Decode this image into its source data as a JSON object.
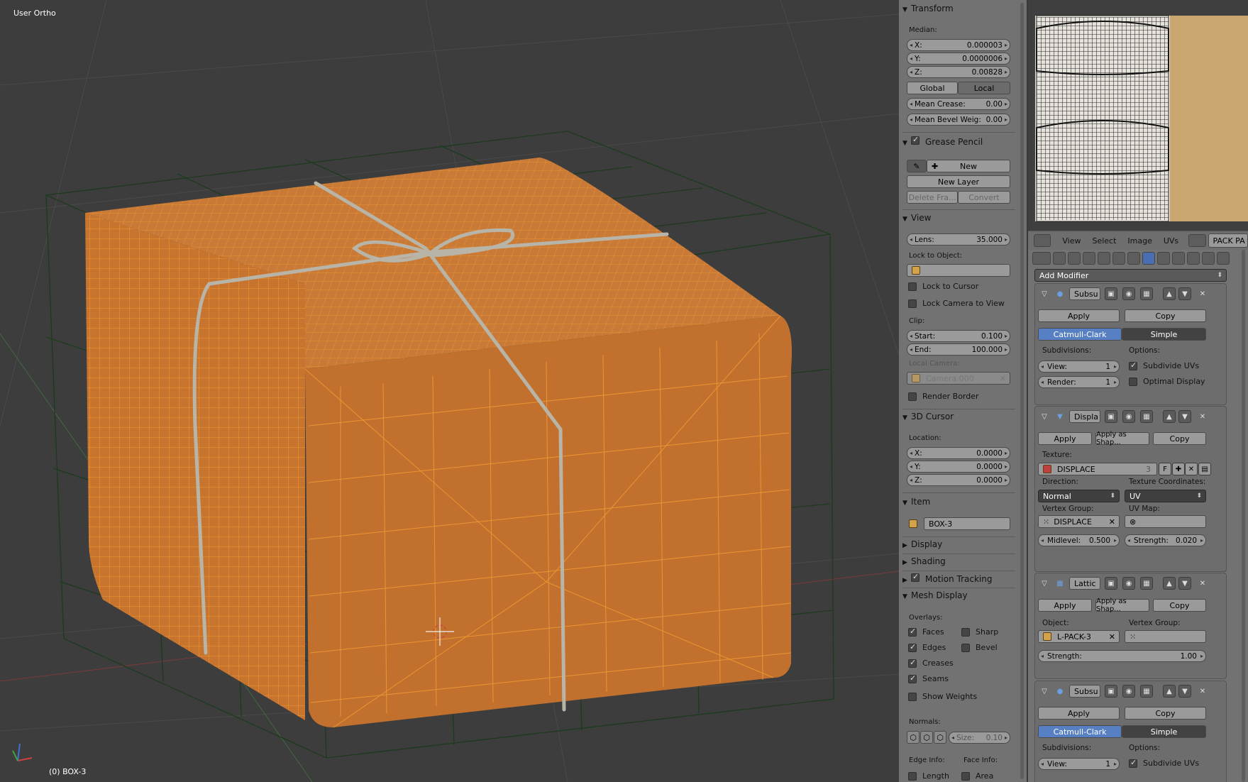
{
  "viewport": {
    "title": "User Ortho",
    "object_label": "(0) BOX-3"
  },
  "npanel": {
    "transform": {
      "header": "Transform",
      "median_label": "Median:",
      "x": {
        "label": "X:",
        "value": "0.000003"
      },
      "y": {
        "label": "Y:",
        "value": "0.0000006"
      },
      "z": {
        "label": "Z:",
        "value": "0.00828"
      },
      "global": "Global",
      "local": "Local",
      "mean_crease": {
        "label": "Mean Crease:",
        "value": "0.00"
      },
      "mean_bevel": {
        "label": "Mean Bevel Weig:",
        "value": "0.00"
      }
    },
    "grease_pencil": {
      "header": "Grease Pencil",
      "new": "New",
      "new_layer": "New Layer",
      "delete_frame": "Delete Fra...",
      "convert": "Convert"
    },
    "view": {
      "header": "View",
      "lens": {
        "label": "Lens:",
        "value": "35.000"
      },
      "lock_to_object": "Lock to Object:",
      "lock_to_cursor": "Lock to Cursor",
      "lock_camera": "Lock Camera to View",
      "clip": "Clip:",
      "start": {
        "label": "Start:",
        "value": "0.100"
      },
      "end": {
        "label": "End:",
        "value": "100.000"
      },
      "local_camera": "Local Camera:",
      "camera": "Camera.000",
      "render_border": "Render Border"
    },
    "cursor": {
      "header": "3D Cursor",
      "location": "Location:",
      "x": {
        "label": "X:",
        "value": "0.0000"
      },
      "y": {
        "label": "Y:",
        "value": "0.0000"
      },
      "z": {
        "label": "Z:",
        "value": "0.0000"
      }
    },
    "item": {
      "header": "Item",
      "name": "BOX-3"
    },
    "display": "Display",
    "shading": "Shading",
    "motion_tracking": "Motion Tracking",
    "mesh_display": {
      "header": "Mesh Display",
      "overlays": "Overlays:",
      "faces": "Faces",
      "sharp": "Sharp",
      "edges": "Edges",
      "bevel": "Bevel",
      "creases": "Creases",
      "seams": "Seams",
      "show_weights": "Show Weights",
      "normals": "Normals:",
      "size": {
        "label": "Size:",
        "value": "0.10"
      },
      "edge_info": "Edge Info:",
      "face_info": "Face Info:",
      "length": "Length",
      "area": "Area"
    }
  },
  "uv_header": {
    "view": "View",
    "select": "Select",
    "image": "Image",
    "uvs": "UVs",
    "image_name": "PACK PA"
  },
  "properties": {
    "add_modifier": "Add Modifier",
    "mod1": {
      "name": "Subsu",
      "apply": "Apply",
      "copy": "Copy",
      "catmull": "Catmull-Clark",
      "simple": "Simple",
      "subdivisions": "Subdivisions:",
      "options": "Options:",
      "view": {
        "label": "View:",
        "value": "1"
      },
      "render": {
        "label": "Render:",
        "value": "1"
      },
      "subdivide_uvs": "Subdivide UVs",
      "optimal_display": "Optimal Display"
    },
    "mod2": {
      "name": "Displa",
      "apply": "Apply",
      "apply_shape": "Apply as Shap...",
      "copy": "Copy",
      "texture": "Texture:",
      "texture_name": "DISPLACE",
      "texture_users": "3",
      "fake": "F",
      "direction": "Direction:",
      "direction_value": "Normal",
      "tex_coords": "Texture Coordinates:",
      "tex_coords_value": "UV",
      "vertex_group": "Vertex Group:",
      "vertex_group_value": "DISPLACE",
      "uv_map": "UV Map:",
      "midlevel": {
        "label": "Midlevel:",
        "value": "0.500"
      },
      "strength": {
        "label": "Strength:",
        "value": "0.020"
      }
    },
    "mod3": {
      "name": "Lattic",
      "apply": "Apply",
      "apply_shape": "Apply as Shap...",
      "copy": "Copy",
      "object": "Object:",
      "object_value": "L-PACK-3",
      "vertex_group": "Vertex Group:",
      "strength": {
        "label": "Strength:",
        "value": "1.00"
      }
    },
    "mod4": {
      "name": "Subsu",
      "apply": "Apply",
      "copy": "Copy",
      "catmull": "Catmull-Clark",
      "simple": "Simple",
      "subdivisions": "Subdivisions:",
      "options": "Options:",
      "view": {
        "label": "View:",
        "value": "1"
      },
      "subdivide_uvs": "Subdivide UVs"
    }
  },
  "colors": {
    "box_orange": "#c8752e",
    "wire_orange": "#ffa030",
    "lattice_green": "#1f3a1f",
    "active_blue": "#5680c2"
  }
}
